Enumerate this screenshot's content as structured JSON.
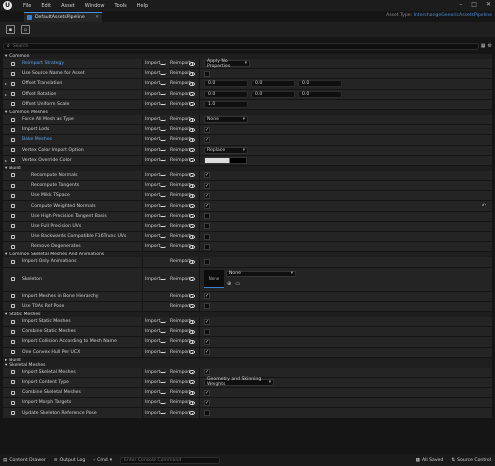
{
  "window": {
    "logo": "U",
    "menu": [
      "File",
      "Edit",
      "Asset",
      "Window",
      "Tools",
      "Help"
    ],
    "controls": [
      "–",
      "□",
      "✕"
    ]
  },
  "tab": {
    "label": "DefaultAssetsPipeline",
    "close": "✕"
  },
  "asset_type": {
    "prefix": "Asset Type:",
    "value": "InterchangeGenericAssetsPipeline"
  },
  "search": {
    "placeholder": "Search"
  },
  "col": {
    "import": "Import",
    "reimport": "Reimport"
  },
  "sections": [
    {
      "label": "Common",
      "rows": [
        {
          "label": "Reimport Strategy",
          "blue": true,
          "value": {
            "type": "dropdown",
            "text": "Apply No Properties"
          }
        },
        {
          "label": "Use Source Name for Asset",
          "value": {
            "type": "check",
            "checked": false
          }
        },
        {
          "label": "Offset Translation",
          "arrow": true,
          "value": {
            "type": "vec",
            "values": [
              "0.0",
              "0.0",
              "0.0"
            ]
          }
        },
        {
          "label": "Offset Rotation",
          "arrow": true,
          "value": {
            "type": "vec",
            "values": [
              "0.0",
              "0.0",
              "0.0"
            ]
          }
        },
        {
          "label": "Offset Uniform Scale",
          "value": {
            "type": "num",
            "text": "1.0"
          }
        }
      ]
    },
    {
      "label": "Common Meshes",
      "rows": [
        {
          "label": "Force All Mesh as Type",
          "value": {
            "type": "dropdown",
            "text": "None"
          }
        },
        {
          "label": "Import Lods",
          "value": {
            "type": "check",
            "checked": true
          }
        },
        {
          "label": "Bake Meshes",
          "blue": true,
          "value": {
            "type": "check",
            "checked": true
          }
        },
        {
          "label": "Vertex Color Import Option",
          "value": {
            "type": "dropdown",
            "text": "Replace"
          }
        },
        {
          "label": "Vertex Override Color",
          "arrow": true,
          "value": {
            "type": "color"
          }
        }
      ]
    },
    {
      "label": "Build",
      "rows": [
        {
          "label": "Recompute Normals",
          "indent": true,
          "value": {
            "type": "check",
            "checked": true
          }
        },
        {
          "label": "Recompute Tangents",
          "indent": true,
          "value": {
            "type": "check",
            "checked": true
          }
        },
        {
          "label": "Use Mikk TSpace",
          "indent": true,
          "value": {
            "type": "check",
            "checked": true
          }
        },
        {
          "label": "Compute Weighted Normals",
          "indent": true,
          "value": {
            "type": "check",
            "checked": true
          },
          "reset": true
        },
        {
          "label": "Use High Precision Tangent Basis",
          "indent": true,
          "value": {
            "type": "check",
            "checked": false
          }
        },
        {
          "label": "Use Full Precision UVs",
          "indent": true,
          "value": {
            "type": "check",
            "checked": false
          }
        },
        {
          "label": "Use Backwards Compatible F16Trunc UVs",
          "indent": true,
          "value": {
            "type": "check",
            "checked": false
          }
        },
        {
          "label": "Remove Degenerates",
          "indent": true,
          "value": {
            "type": "check",
            "checked": false
          }
        }
      ]
    },
    {
      "label": "Common Skeletal Meshes And Animations",
      "rows": [
        {
          "label": "Import Only Animations",
          "noimp": true,
          "value": {
            "type": "check",
            "checked": false
          }
        },
        {
          "label": "Skeleton",
          "tall": true,
          "value": {
            "type": "skeleton",
            "thumb": "None",
            "text": "None"
          }
        },
        {
          "label": "Import Meshes in Bone Hierarchy",
          "noimp": true,
          "value": {
            "type": "check",
            "checked": true
          }
        },
        {
          "label": "Use T0As Ref Pose",
          "noimp": true,
          "value": {
            "type": "check",
            "checked": false
          }
        }
      ]
    },
    {
      "label": "Static Meshes",
      "rows": [
        {
          "label": "Import Static Meshes",
          "value": {
            "type": "check",
            "checked": true
          }
        },
        {
          "label": "Combine Static Meshes",
          "value": {
            "type": "check",
            "checked": false
          }
        },
        {
          "label": "Import Collision According to Mesh Name",
          "value": {
            "type": "check",
            "checked": true
          }
        },
        {
          "label": "One Convex Hull Per UCX",
          "value": {
            "type": "check",
            "checked": true
          }
        }
      ]
    },
    {
      "label": "Build",
      "collapsed": true,
      "rows": []
    },
    {
      "label": "Skeletal Meshes",
      "rows": [
        {
          "label": "Import Skeletal Meshes",
          "value": {
            "type": "check",
            "checked": true
          }
        },
        {
          "label": "Import Content Type",
          "value": {
            "type": "dropdown",
            "text": "Geometry and Skinning Weights"
          }
        },
        {
          "label": "Combine Skeletal Meshes",
          "value": {
            "type": "check",
            "checked": true
          }
        },
        {
          "label": "Import Morph Targets",
          "value": {
            "type": "check",
            "checked": true
          }
        },
        {
          "label": "Update Skeleton Reference Pose",
          "value": {
            "type": "check",
            "checked": false
          }
        }
      ]
    }
  ],
  "statusbar": {
    "content_drawer": "Content Drawer",
    "output_log": "Output Log",
    "cmd": "Cmd",
    "console_placeholder": "Enter Console Command",
    "all_saved": "All Saved",
    "source_control": "Source Control"
  }
}
